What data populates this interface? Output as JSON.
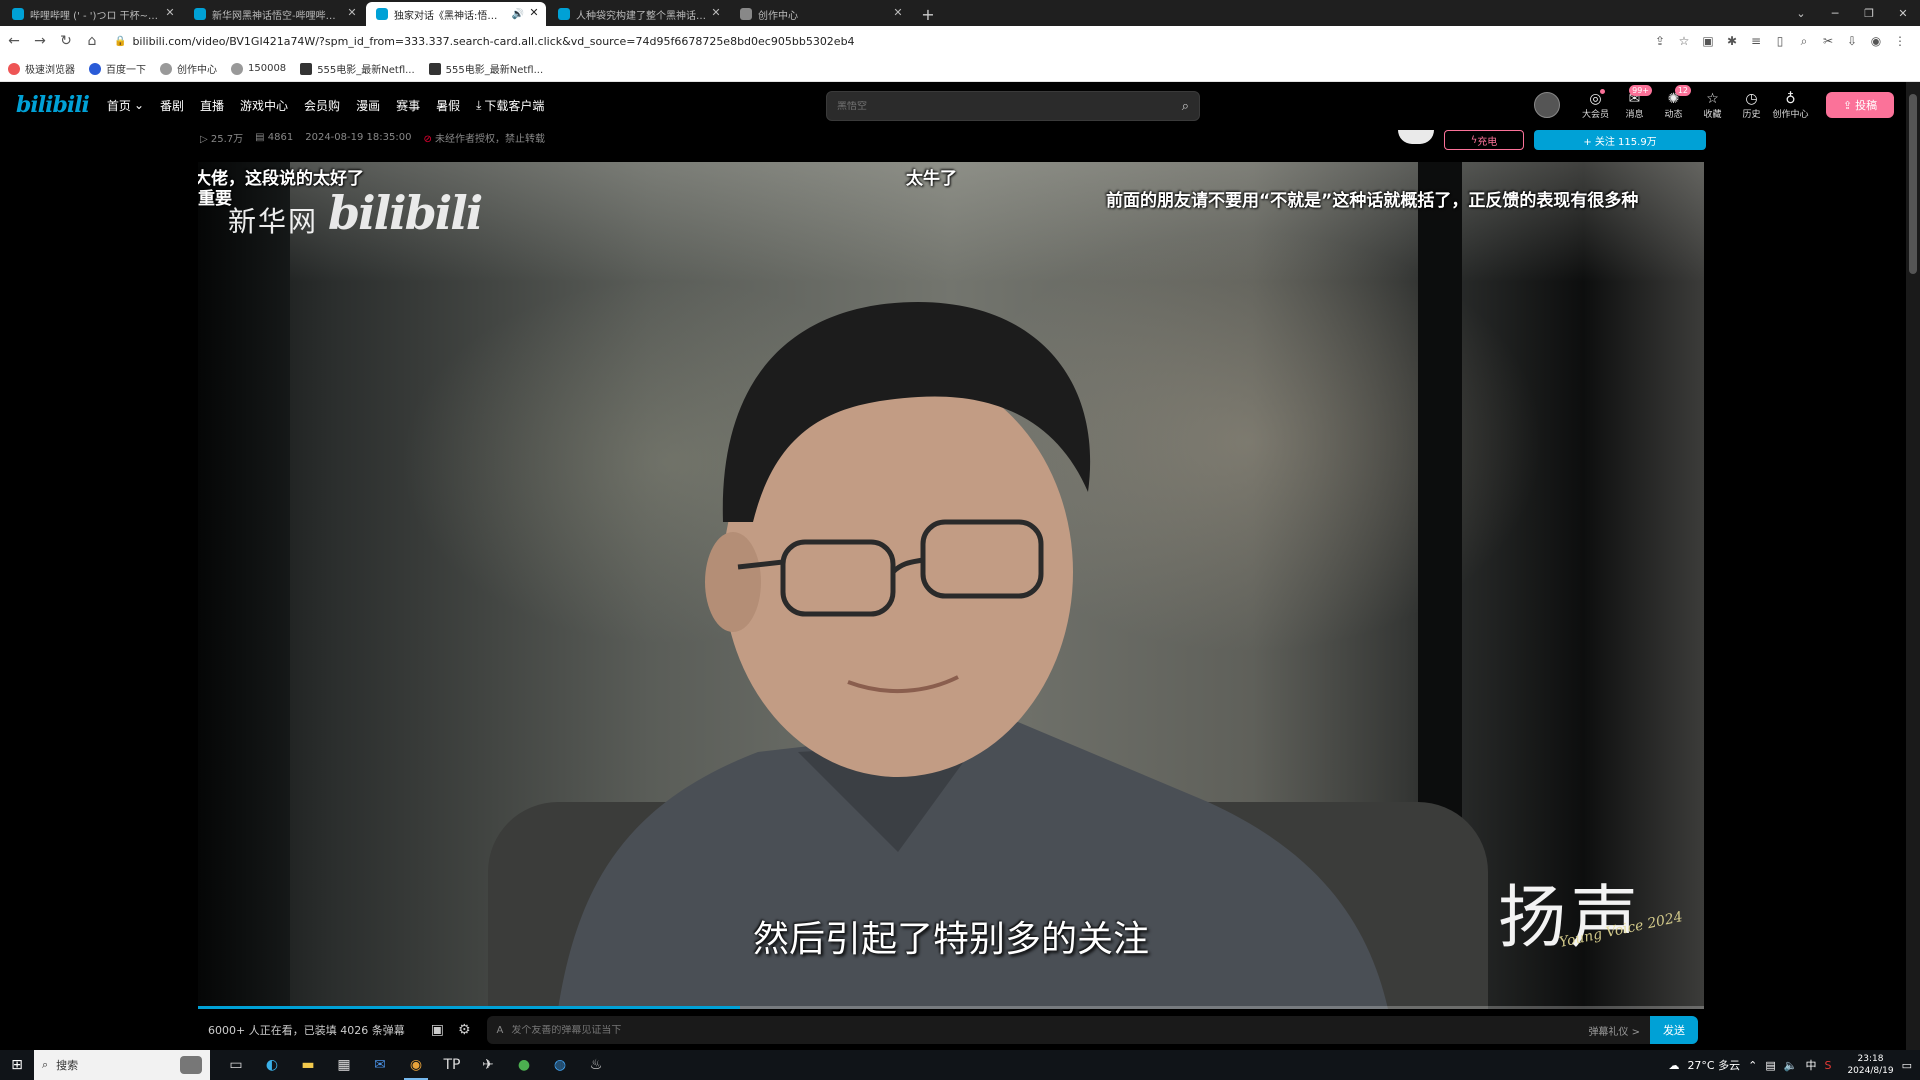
{
  "browser": {
    "tabs": [
      {
        "title": "哔哩哔哩 (' - ')つロ 干杯~-bili",
        "active": false
      },
      {
        "title": "新华网黑神话悟空-哔哩哔哩_bili",
        "active": false
      },
      {
        "title": "独家对话《黑神话:悟空》制",
        "active": true
      },
      {
        "title": "人种袋究构建了整个黑神话世界",
        "active": false
      },
      {
        "title": "创作中心",
        "active": false
      }
    ],
    "url": "bilibili.com/video/BV1GI421a74W/?spm_id_from=333.337.search-card.all.click&vd_source=74d95f6678725e8bd0ec905bb5302eb4",
    "bookmarks": [
      "极速浏览器",
      "百度一下",
      "创作中心",
      "150008",
      "555电影_最新Netfl...",
      "555电影_最新Netfl..."
    ]
  },
  "nav": {
    "links": [
      "首页",
      "番剧",
      "直播",
      "游戏中心",
      "会员购",
      "漫画",
      "赛事",
      "暑假",
      "下载客户端"
    ],
    "search_placeholder": "黑悟空",
    "right_items": [
      {
        "label": "大会员",
        "icon": "vip-icon"
      },
      {
        "label": "消息",
        "icon": "message-icon",
        "badge": "99+"
      },
      {
        "label": "动态",
        "icon": "dynamic-icon",
        "badge": "12"
      },
      {
        "label": "收藏",
        "icon": "star-icon"
      },
      {
        "label": "历史",
        "icon": "clock-icon"
      },
      {
        "label": "创作中心",
        "icon": "bulb-icon"
      }
    ],
    "upload_label": "投稿"
  },
  "video_meta": {
    "views": "25.7万",
    "danmaku_count": "4861",
    "datetime": "2024-08-19 18:35:00",
    "notice": "未经作者授权，禁止转载"
  },
  "uploader": {
    "charge_label": "充电",
    "follow_label": "+ 关注 115.9万"
  },
  "player": {
    "watermark_left": "新华网",
    "watermark_logo": "bilibili",
    "watermark_right": "扬声",
    "watermark_right_sub": "Young Voice 2024",
    "subtitle": "然后引起了特别多的关注",
    "danmaku": [
      {
        "text": "大佬，这段说的太好了"
      },
      {
        "text": "重要"
      },
      {
        "text": "太牛了"
      },
      {
        "text": "前面的朋友请不要用“不就是”这种话就概括了，正反馈的表现有很多种"
      }
    ],
    "progress": 0.36
  },
  "danmaku_bar": {
    "viewers": "6000+ 人正在看，已装填 4026 条弹幕",
    "input_placeholder": "发个友善的弹幕见证当下",
    "etiquette": "弹幕礼仪 >",
    "send_label": "发送"
  },
  "taskbar": {
    "search_label": "搜索",
    "weather": "27°C 多云",
    "ime": "中",
    "time": "23:18",
    "date": "2024/8/19"
  }
}
